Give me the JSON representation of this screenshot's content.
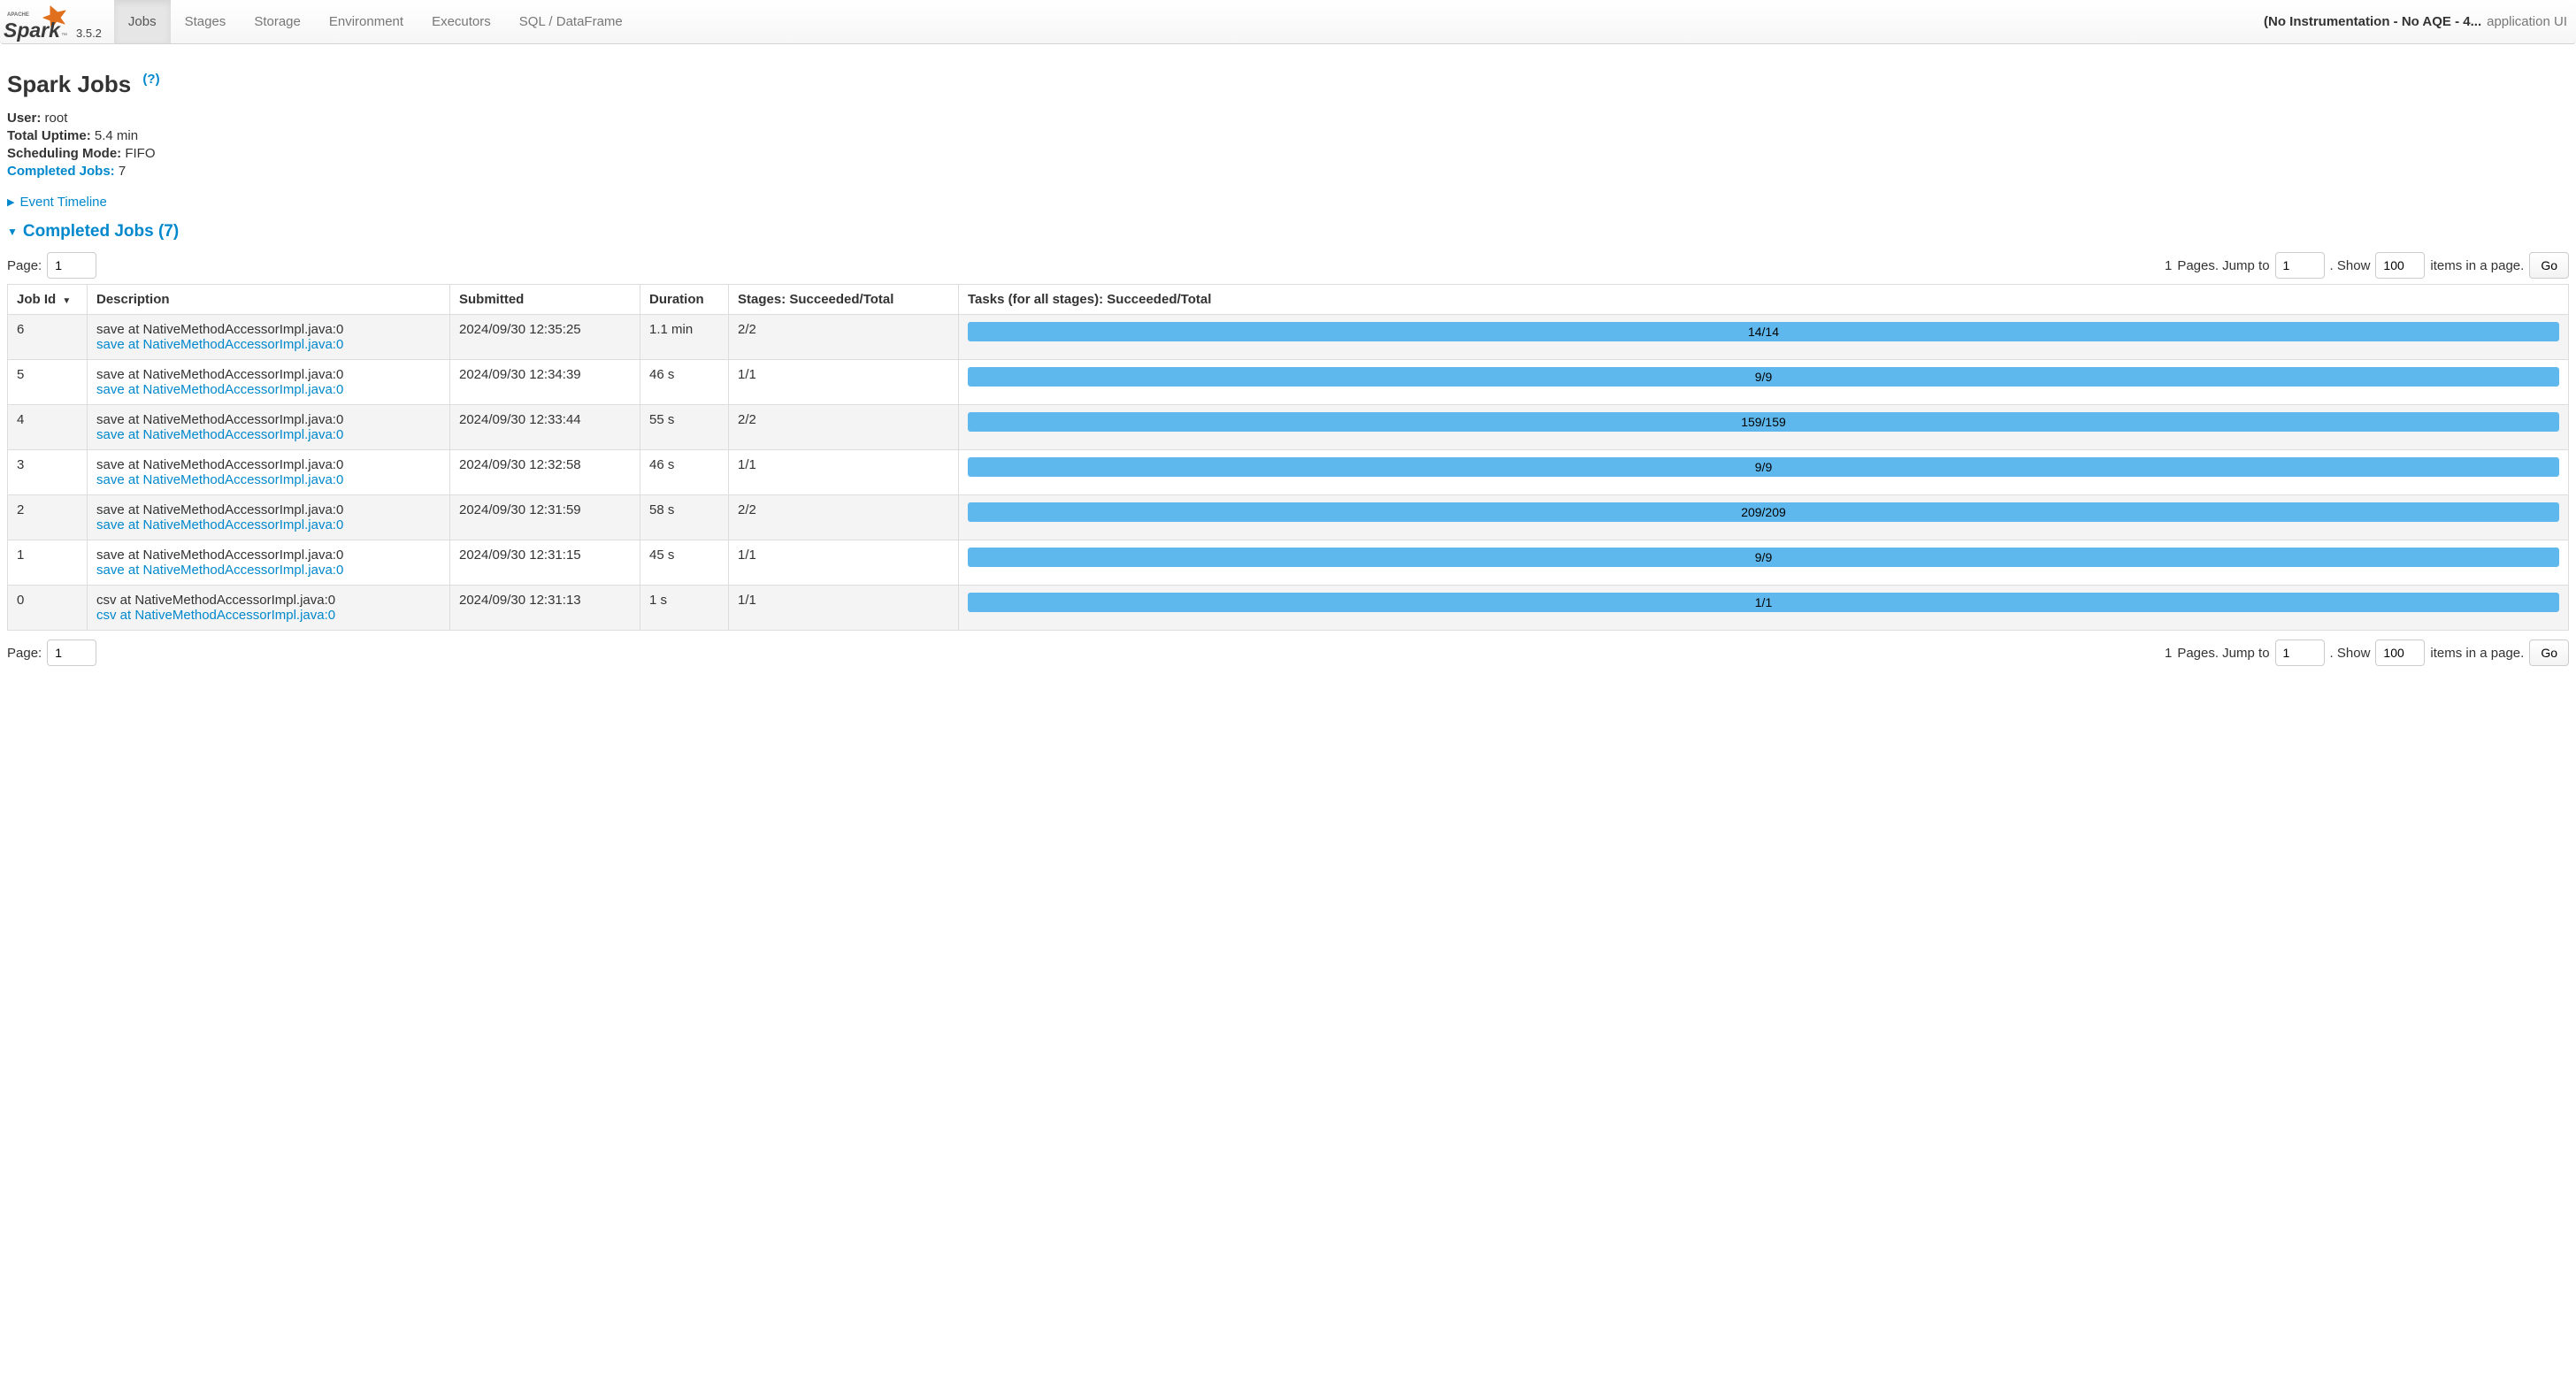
{
  "navbar": {
    "version": "3.5.2",
    "tabs": [
      {
        "key": "jobs",
        "label": "Jobs",
        "active": true
      },
      {
        "key": "stages",
        "label": "Stages",
        "active": false
      },
      {
        "key": "storage",
        "label": "Storage",
        "active": false
      },
      {
        "key": "environment",
        "label": "Environment",
        "active": false
      },
      {
        "key": "executors",
        "label": "Executors",
        "active": false
      },
      {
        "key": "sql",
        "label": "SQL / DataFrame",
        "active": false
      }
    ],
    "app_name_truncated": "(No Instrumentation - No AQE - 4...",
    "app_suffix": "application UI"
  },
  "title": "Spark Jobs",
  "help_marker": "(?)",
  "summary": {
    "user_label": "User:",
    "user_value": "root",
    "uptime_label": "Total Uptime:",
    "uptime_value": "5.4 min",
    "sched_label": "Scheduling Mode:",
    "sched_value": "FIFO",
    "completed_label": "Completed Jobs:",
    "completed_value": "7"
  },
  "event_timeline_label": "Event Timeline",
  "completed_section_label": "Completed Jobs (7)",
  "pagination": {
    "page_label": "Page:",
    "page_value": "1",
    "total_pages_prefix": "1",
    "pages_jump_text": "Pages. Jump to",
    "jump_value": "1",
    "show_text": ". Show",
    "show_value": "100",
    "items_suffix": "items in a page.",
    "go_label": "Go"
  },
  "table": {
    "headers": {
      "job_id": "Job Id",
      "description": "Description",
      "submitted": "Submitted",
      "duration": "Duration",
      "stages": "Stages: Succeeded/Total",
      "tasks": "Tasks (for all stages): Succeeded/Total"
    },
    "rows": [
      {
        "id": "6",
        "desc": "save at NativeMethodAccessorImpl.java:0",
        "link": "save at NativeMethodAccessorImpl.java:0",
        "submitted": "2024/09/30 12:35:25",
        "duration": "1.1 min",
        "stages": "2/2",
        "tasks": "14/14"
      },
      {
        "id": "5",
        "desc": "save at NativeMethodAccessorImpl.java:0",
        "link": "save at NativeMethodAccessorImpl.java:0",
        "submitted": "2024/09/30 12:34:39",
        "duration": "46 s",
        "stages": "1/1",
        "tasks": "9/9"
      },
      {
        "id": "4",
        "desc": "save at NativeMethodAccessorImpl.java:0",
        "link": "save at NativeMethodAccessorImpl.java:0",
        "submitted": "2024/09/30 12:33:44",
        "duration": "55 s",
        "stages": "2/2",
        "tasks": "159/159"
      },
      {
        "id": "3",
        "desc": "save at NativeMethodAccessorImpl.java:0",
        "link": "save at NativeMethodAccessorImpl.java:0",
        "submitted": "2024/09/30 12:32:58",
        "duration": "46 s",
        "stages": "1/1",
        "tasks": "9/9"
      },
      {
        "id": "2",
        "desc": "save at NativeMethodAccessorImpl.java:0",
        "link": "save at NativeMethodAccessorImpl.java:0",
        "submitted": "2024/09/30 12:31:59",
        "duration": "58 s",
        "stages": "2/2",
        "tasks": "209/209"
      },
      {
        "id": "1",
        "desc": "save at NativeMethodAccessorImpl.java:0",
        "link": "save at NativeMethodAccessorImpl.java:0",
        "submitted": "2024/09/30 12:31:15",
        "duration": "45 s",
        "stages": "1/1",
        "tasks": "9/9"
      },
      {
        "id": "0",
        "desc": "csv at NativeMethodAccessorImpl.java:0",
        "link": "csv at NativeMethodAccessorImpl.java:0",
        "submitted": "2024/09/30 12:31:13",
        "duration": "1 s",
        "stages": "1/1",
        "tasks": "1/1"
      }
    ]
  }
}
